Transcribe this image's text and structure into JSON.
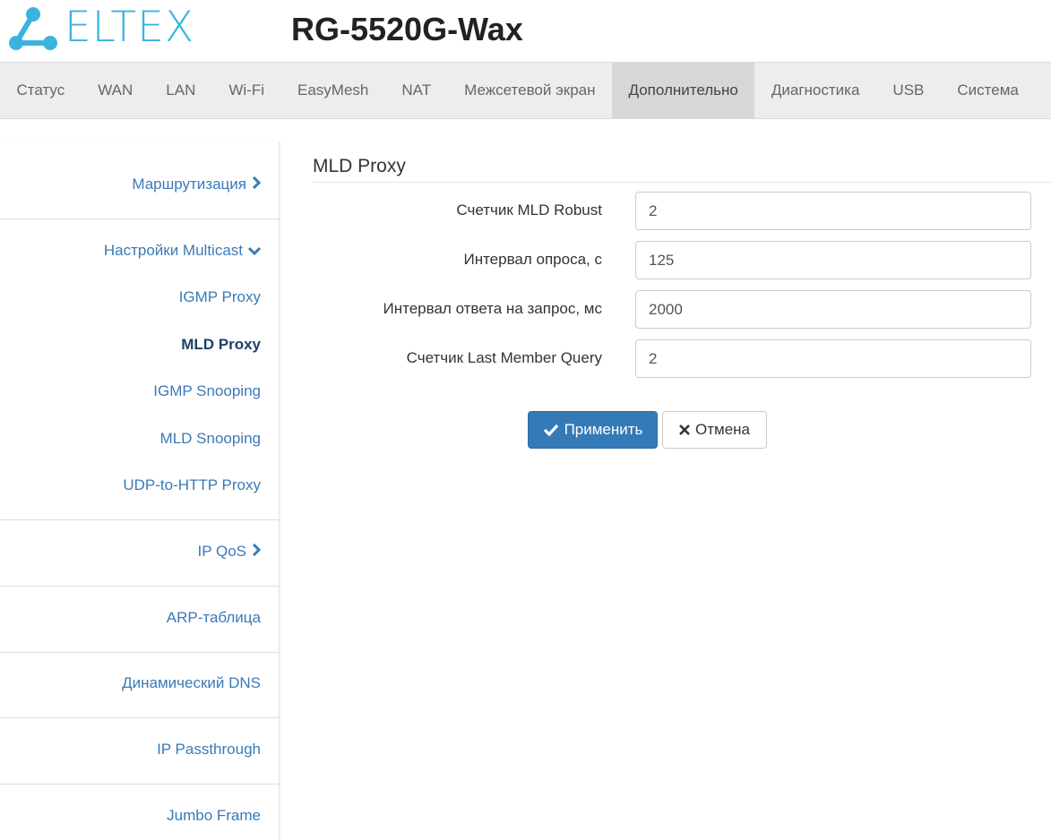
{
  "header": {
    "logo_text": "ELTEX",
    "model": "RG-5520G-Wax"
  },
  "nav": {
    "tabs": [
      {
        "label": "Статус"
      },
      {
        "label": "WAN"
      },
      {
        "label": "LAN"
      },
      {
        "label": "Wi-Fi"
      },
      {
        "label": "EasyMesh"
      },
      {
        "label": "NAT"
      },
      {
        "label": "Межсетевой экран"
      },
      {
        "label": "Дополнительно",
        "active": true
      },
      {
        "label": "Диагностика"
      },
      {
        "label": "USB"
      },
      {
        "label": "Система"
      }
    ]
  },
  "sidebar": {
    "routing": "Маршрутизация",
    "multicast": "Настройки Multicast",
    "igmp_proxy": "IGMP Proxy",
    "mld_proxy": "MLD Proxy",
    "igmp_snooping": "IGMP Snooping",
    "mld_snooping": "MLD Snooping",
    "udp_http": "UDP-to-HTTP Proxy",
    "ip_qos": "IP QoS",
    "arp": "ARP-таблица",
    "ddns": "Динамический DNS",
    "ip_passthrough": "IP Passthrough",
    "jumbo": "Jumbo Frame"
  },
  "main": {
    "title": "MLD Proxy",
    "fields": [
      {
        "label": "Счетчик MLD Robust",
        "value": "2"
      },
      {
        "label": "Интервал опроса, с",
        "value": "125"
      },
      {
        "label": "Интервал ответа на запрос, мс",
        "value": "2000"
      },
      {
        "label": "Счетчик Last Member Query",
        "value": "2"
      }
    ],
    "apply_label": "Применить",
    "cancel_label": "Отмена"
  },
  "colors": {
    "brand": "#3bb3e0",
    "link": "#3a7ab7",
    "primary_button": "#337ab7"
  }
}
